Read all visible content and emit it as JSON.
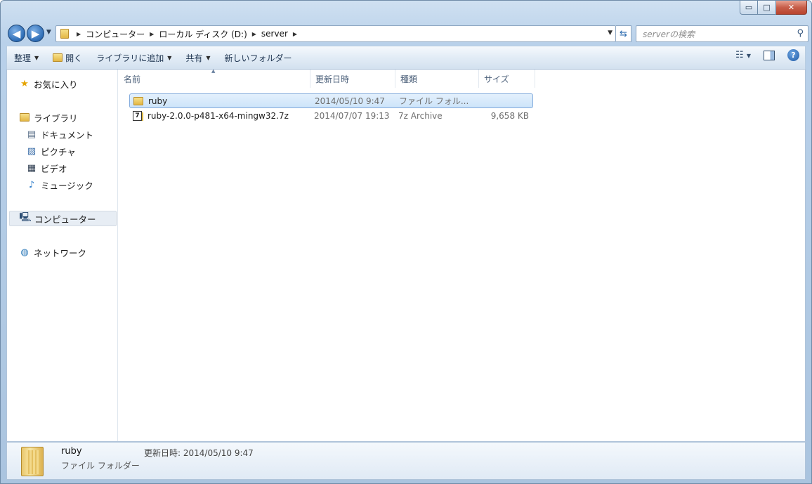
{
  "window": {
    "caption_buttons": {
      "minimize": "▭",
      "maximize": "□",
      "close": "✕"
    }
  },
  "address_bar": {
    "crumbs": [
      "コンピューター",
      "ローカル ディスク (D:)",
      "server"
    ],
    "search_placeholder": "serverの検索"
  },
  "toolbar": {
    "organize": "整理",
    "open": "開く",
    "add_to_library": "ライブラリに追加",
    "share": "共有",
    "new_folder": "新しいフォルダー"
  },
  "nav_pane": {
    "favorites": "お気に入り",
    "libraries": "ライブラリ",
    "documents": "ドキュメント",
    "pictures": "ピクチャ",
    "videos": "ビデオ",
    "music": "ミュージック",
    "computer": "コンピューター",
    "network": "ネットワーク"
  },
  "columns": {
    "name": "名前",
    "date": "更新日時",
    "type": "種類",
    "size": "サイズ"
  },
  "files": [
    {
      "name": "ruby",
      "date": "2014/05/10 9:47",
      "type": "ファイル フォル...",
      "size": "",
      "icon": "folder-icon"
    },
    {
      "name": "ruby-2.0.0-p481-x64-mingw32.7z",
      "date": "2014/07/07 19:13",
      "type": "7z Archive",
      "size": "9,658 KB",
      "icon": "7z-archive-icon"
    }
  ],
  "details": {
    "name": "ruby",
    "type": "ファイル フォルダー",
    "modified": "更新日時: 2014/05/10 9:47"
  }
}
